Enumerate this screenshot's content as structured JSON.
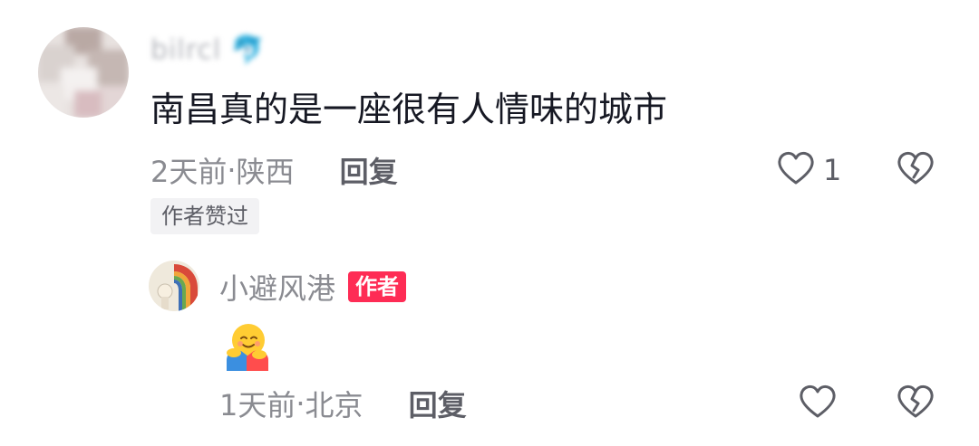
{
  "comment": {
    "username": "bilrcl 🐬",
    "text": "南昌真的是一座很有人情味的城市",
    "time": "2天前",
    "separator": " · ",
    "location": "陕西",
    "reply_label": "回复",
    "like_count": "1",
    "author_liked_label": "作者赞过",
    "avatar_icon": "blurred-avatar"
  },
  "reply": {
    "username": "小避风港",
    "author_badge": "作者",
    "emoji_icon": "hugging-face-emoji",
    "time": "1天前",
    "separator": " · ",
    "location": "北京",
    "reply_label": "回复",
    "avatar_icon": "rainbow-avatar"
  },
  "colors": {
    "text_primary": "#161823",
    "text_secondary": "#8a8b91",
    "author_badge_bg": "#fe2c55",
    "tag_bg": "#f2f2f4"
  }
}
